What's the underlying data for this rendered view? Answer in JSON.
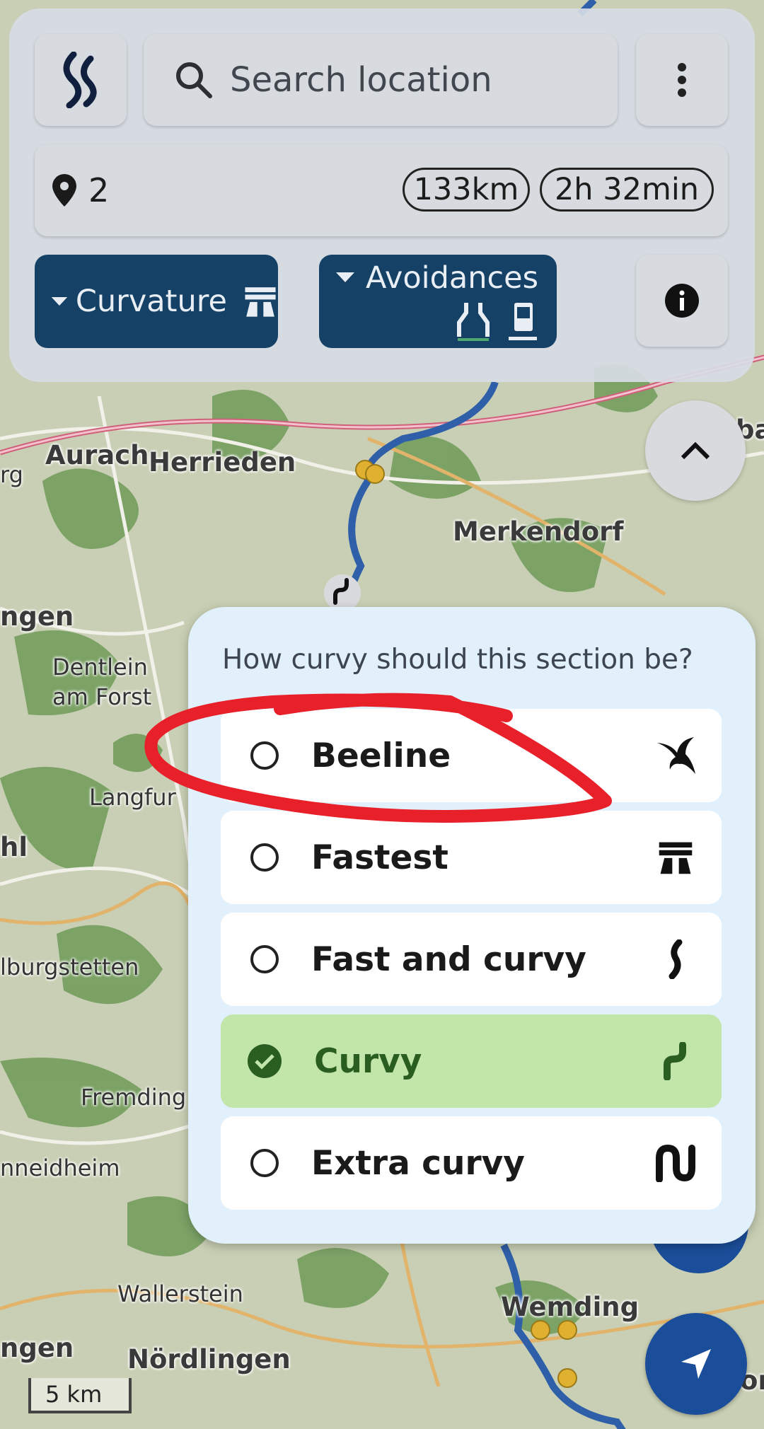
{
  "search": {
    "placeholder": "Search location"
  },
  "route": {
    "waypoint_count": "2",
    "distance": "133km",
    "duration": "2h 32min"
  },
  "controls": {
    "curvature_label": "Curvature",
    "avoidances_label": "Avoidances"
  },
  "map": {
    "labels": [
      "Aurach",
      "Herrieden",
      "Merkendorf",
      "Dentlein am Forst",
      "Langfur",
      "Fremding",
      "Wallerstein",
      "Nördlingen",
      "Wemding",
      "rg",
      "ngen",
      "hl",
      "lburgstetten",
      "nneidheim",
      "ngen",
      "on",
      "ba"
    ],
    "scale": "5 km"
  },
  "popup": {
    "question": "How curvy should this section be?",
    "options": [
      {
        "label": "Beeline",
        "icon": "swallow-icon",
        "selected": false
      },
      {
        "label": "Fastest",
        "icon": "motorway-icon",
        "selected": false
      },
      {
        "label": "Fast and curvy",
        "icon": "slight-curve-icon",
        "selected": false
      },
      {
        "label": "Curvy",
        "icon": "curve-icon",
        "selected": true
      },
      {
        "label": "Extra curvy",
        "icon": "zigzag-icon",
        "selected": false
      }
    ]
  },
  "colors": {
    "panel_blue": "#154166",
    "selected_green": "#c2e5aa",
    "route_blue": "#2f5fa8",
    "annotation_red": "#e8202a"
  }
}
